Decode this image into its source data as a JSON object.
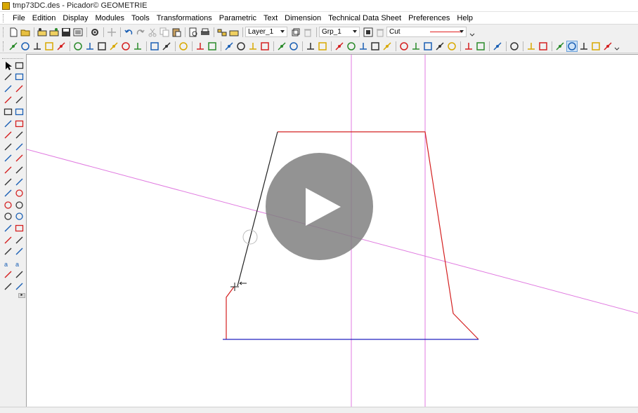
{
  "window": {
    "title": "tmp73DC.des - Picador© GEOMETRIE"
  },
  "menu": [
    "File",
    "Edition",
    "Display",
    "Modules",
    "Tools",
    "Transformations",
    "Parametric",
    "Text",
    "Dimension",
    "Technical Data Sheet",
    "Preferences",
    "Help"
  ],
  "toolbar": {
    "layer_value": "Layer_1",
    "group_value": "Grp_1",
    "linetype_value": "Cut",
    "line_color": "#e02020"
  },
  "canvas": {
    "construction_color": "#e07ae0",
    "profile_color": "#d42020",
    "edit_line_color": "#222222",
    "base_line_color": "#2020c0"
  },
  "icons": [
    "new-file-icon",
    "open-file-icon",
    "save-icon",
    "print-icon",
    "undo-icon",
    "redo-icon",
    "cut-icon",
    "copy-icon",
    "paste-icon",
    "zoom-icon",
    "layer-icon",
    "group-icon",
    "select-arrow-icon",
    "eraser-icon",
    "line-icon",
    "rectangle-icon",
    "circle-icon",
    "text-icon",
    "play-icon"
  ]
}
